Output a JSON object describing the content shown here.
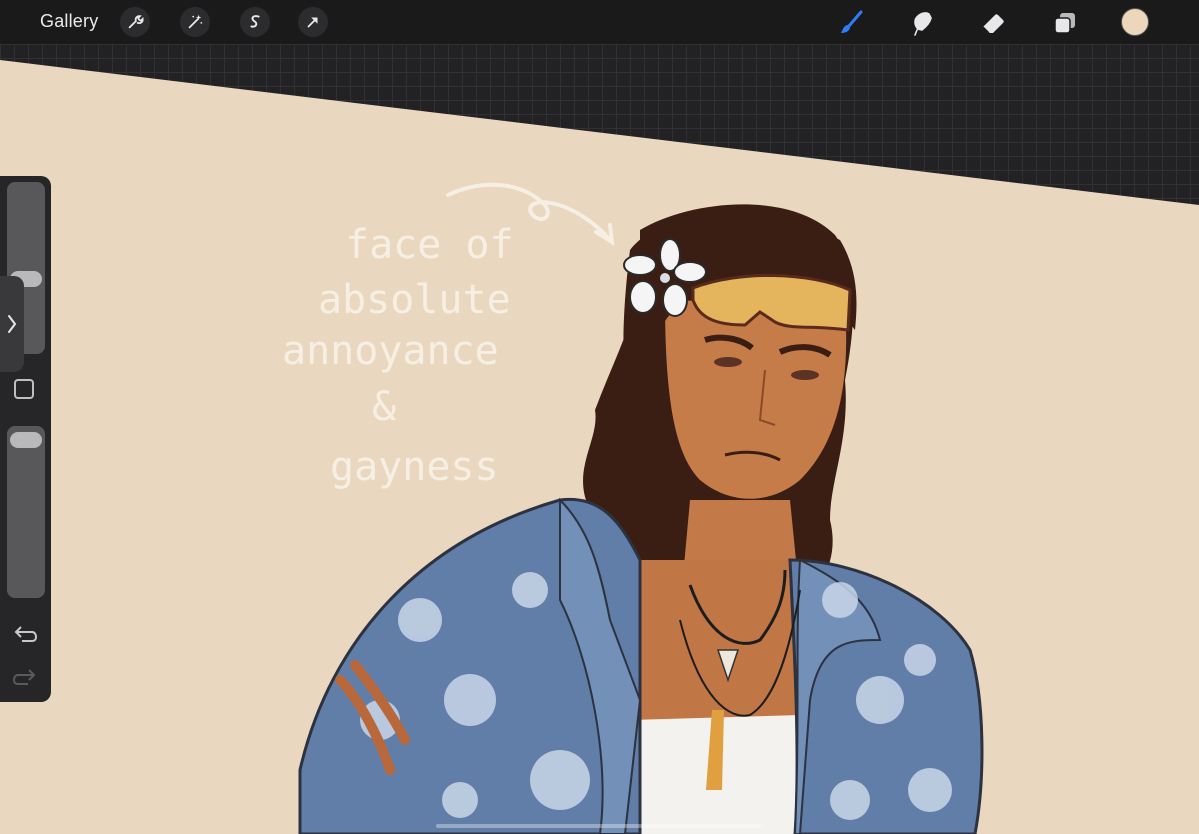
{
  "topbar": {
    "gallery_label": "Gallery",
    "left_tools": [
      "actions-wrench-icon",
      "adjustments-wand-icon",
      "selection-s-icon",
      "transform-arrow-icon"
    ],
    "right_tools": [
      "brush-icon",
      "smudge-icon",
      "eraser-icon",
      "layers-icon"
    ],
    "active_tool": "brush-icon",
    "accent_color": "#2f7cf6",
    "current_color": "#ecd6bc"
  },
  "sidebar": {
    "size_slider_value": 0.55,
    "opacity_slider_value": 0.95,
    "undo_icon": "undo-arrow-icon",
    "redo_icon": "redo-arrow-icon",
    "modify_icon": "square-modify-icon",
    "collapse_icon": "chevron-right-icon"
  },
  "canvas": {
    "background_color": "#ead7bf",
    "handwritten_note": [
      "face of",
      "absolute",
      "annoyance",
      "&",
      "gayness"
    ],
    "note_color": "#f6efe4"
  }
}
